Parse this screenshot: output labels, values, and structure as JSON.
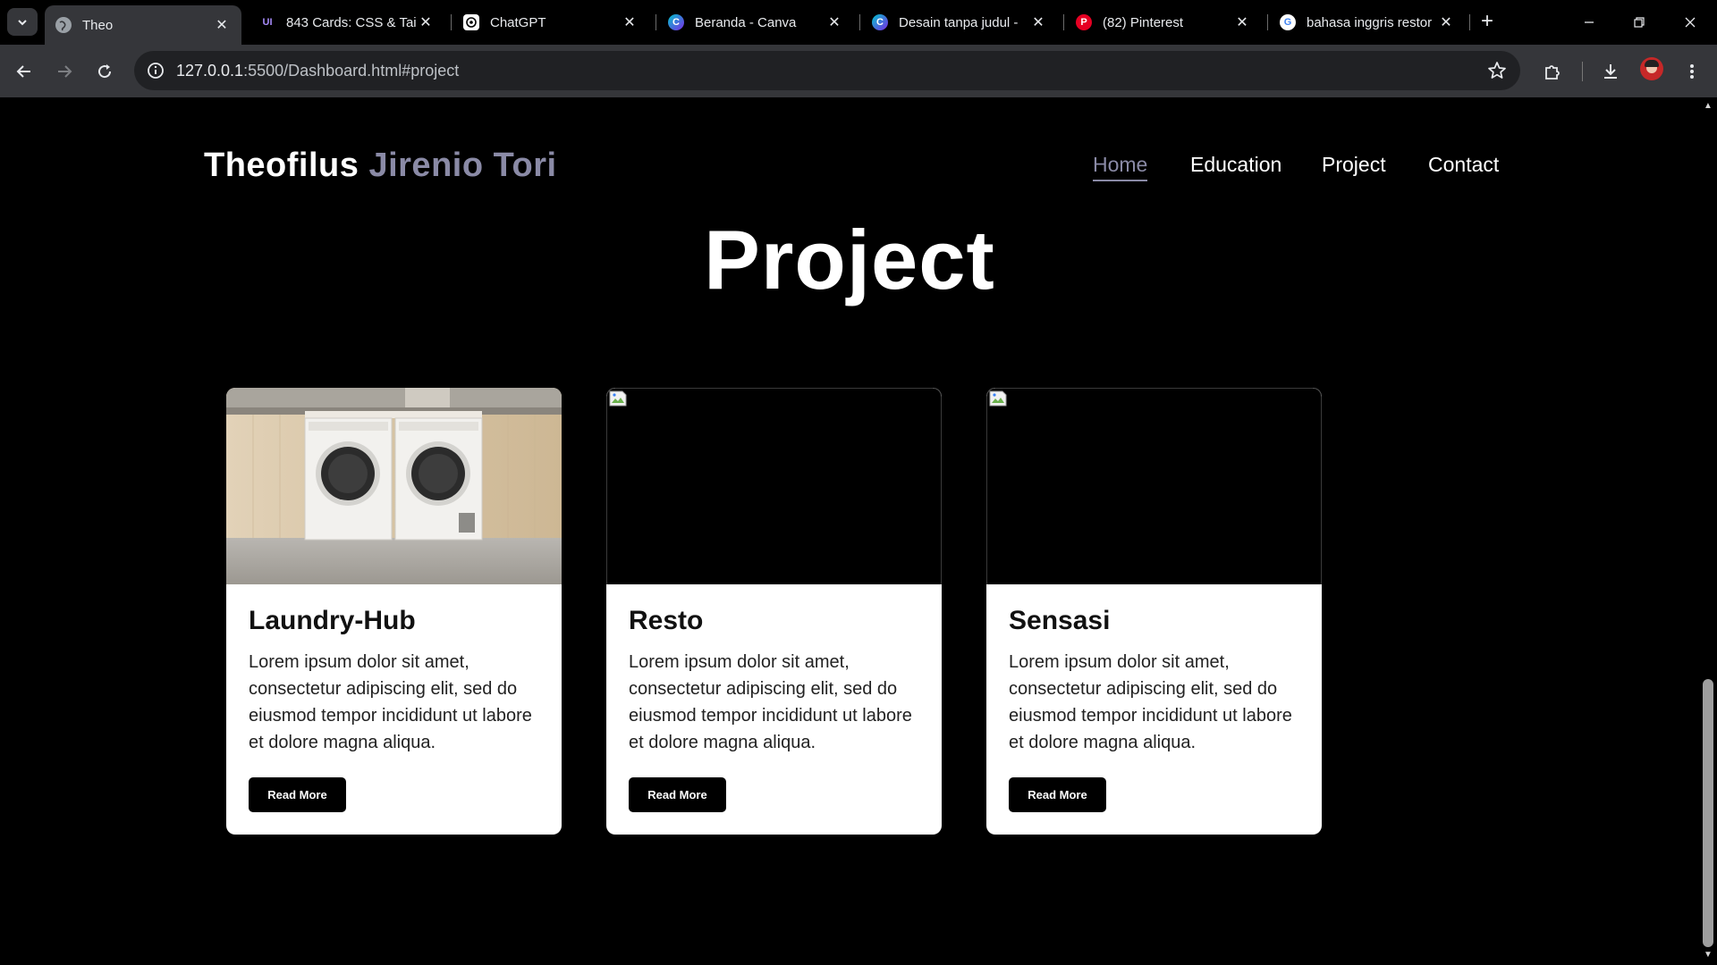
{
  "browser": {
    "tabs": [
      {
        "title": "Theo",
        "active": true,
        "icon": "globe-icon"
      },
      {
        "title": "843 Cards: CSS & Tai",
        "active": false,
        "icon": "uiverse-icon"
      },
      {
        "title": "ChatGPT",
        "active": false,
        "icon": "chatgpt-icon"
      },
      {
        "title": "Beranda - Canva",
        "active": false,
        "icon": "canva-icon"
      },
      {
        "title": "Desain tanpa judul -",
        "active": false,
        "icon": "canva-icon"
      },
      {
        "title": "(82) Pinterest",
        "active": false,
        "icon": "pinterest-icon"
      },
      {
        "title": "bahasa inggris restor",
        "active": false,
        "icon": "google-icon"
      }
    ],
    "url_host": "127.0.0.1",
    "url_rest": ":5500/Dashboard.html#project",
    "colors": {
      "tabstrip": "#000000",
      "toolbar": "#35363a",
      "omnibox": "#202124"
    }
  },
  "site": {
    "brand_first": "Theofilus",
    "brand_second": "Jirenio Tori",
    "nav": [
      {
        "label": "Home",
        "active": true
      },
      {
        "label": "Education",
        "active": false
      },
      {
        "label": "Project",
        "active": false
      },
      {
        "label": "Contact",
        "active": false
      }
    ],
    "section_title": "Project",
    "accent_color": "#8a8aa6",
    "cards": [
      {
        "title": "Laundry-Hub",
        "description": "Lorem ipsum dolor sit amet, consectetur adipiscing elit, sed do eiusmod tempor incididunt ut labore et dolore magna aliqua.",
        "button": "Read More",
        "image": "washing-machines-photo"
      },
      {
        "title": "Resto",
        "description": "Lorem ipsum dolor sit amet, consectetur adipiscing elit, sed do eiusmod tempor incididunt ut labore et dolore magna aliqua.",
        "button": "Read More",
        "image": "broken-image-icon"
      },
      {
        "title": "Sensasi",
        "description": "Lorem ipsum dolor sit amet, consectetur adipiscing elit, sed do eiusmod tempor incididunt ut labore et dolore magna aliqua.",
        "button": "Read More",
        "image": "broken-image-icon"
      }
    ]
  }
}
